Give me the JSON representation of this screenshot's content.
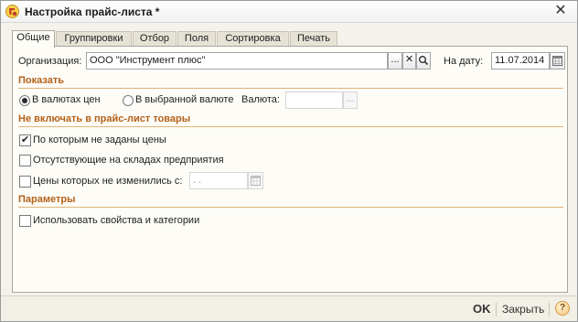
{
  "window": {
    "title": "Настройка прайс-листа *"
  },
  "tabs": [
    {
      "label": "Общие",
      "active": true
    },
    {
      "label": "Группировки"
    },
    {
      "label": "Отбор"
    },
    {
      "label": "Поля"
    },
    {
      "label": "Сортировка"
    },
    {
      "label": "Печать"
    }
  ],
  "organization": {
    "label": "Организация:",
    "value": "ООО \"Инструмент плюс\"",
    "select_button": "...",
    "clear_button": "✕",
    "open_icon": "search-icon"
  },
  "date": {
    "label": "На дату:",
    "value": "11.07.2014",
    "calendar_icon": "calendar-icon"
  },
  "show": {
    "header": "Показать",
    "option1": {
      "label": "В валютах цен",
      "selected": true
    },
    "option2": {
      "label": "В выбранной валюте",
      "selected": false
    },
    "currency_label": "Валюта:",
    "currency_value": "",
    "currency_button": "..."
  },
  "exclude": {
    "header": "Не включать в прайс-лист товары",
    "no_prices": {
      "label": "По которым не заданы цены",
      "checked": true
    },
    "out_of_stock": {
      "label": "Отсутствующие на складах предприятия",
      "checked": false
    },
    "unchanged": {
      "label": "Цены которых не изменились с:",
      "checked": false
    },
    "unchanged_date": " .  ."
  },
  "params": {
    "header": "Параметры",
    "use_properties": {
      "label": "Использовать свойства и категории",
      "checked": false
    }
  },
  "footer": {
    "ok": "OK",
    "close": "Закрыть",
    "help": "?"
  },
  "colors": {
    "section_header": "#b3611a",
    "section_line": "#e1b47a",
    "background": "#f4f2ea",
    "panel": "#fdfcf7"
  }
}
